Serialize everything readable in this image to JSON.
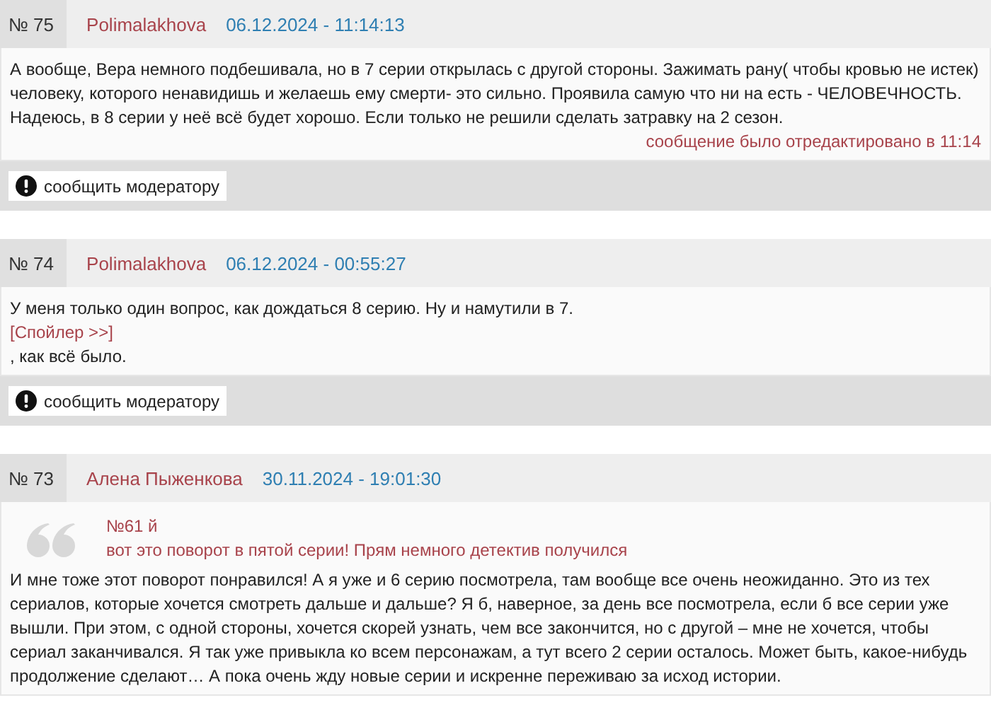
{
  "comments": [
    {
      "number": "№ 75",
      "author": "Polimalakhova",
      "date": "06.12.2024 - 11:14:13",
      "body": [
        {
          "kind": "text",
          "text": "А вообще, Вера немного подбешивала, но в 7 серии открылась с другой стороны. Зажимать рану( чтобы кровью не истек) человеку, которого ненавидишь и желаешь ему смерти- это сильно. Проявила самую что ни на есть - ЧЕЛОВЕЧНОСТЬ. Надеюсь, в 8 серии у неё всё будет хорошо. Если только не решили сделать затравку на 2 сезон."
        }
      ],
      "edited": "сообщение было отредактировано в 11:14",
      "report": "сообщить модератору"
    },
    {
      "number": "№ 74",
      "author": "Polimalakhova",
      "date": "06.12.2024 - 00:55:27",
      "body": [
        {
          "kind": "text",
          "text": "У меня только один вопрос, как дождаться 8 серию. Ну и намутили в 7."
        },
        {
          "kind": "spoiler",
          "text": "[Спойлер >>]"
        },
        {
          "kind": "text",
          "text": ", как всё было."
        }
      ],
      "report": "сообщить модератору"
    },
    {
      "number": "№ 73",
      "author": "Алена Пыженкова",
      "date": "30.11.2024 - 19:01:30",
      "quote": {
        "ref": "№61 й",
        "text": "вот это поворот в пятой серии! Прям немного детектив получился"
      },
      "body": [
        {
          "kind": "text",
          "text": "И мне тоже этот поворот понравился! А я уже и 6 серию посмотрела, там вообще все очень неожиданно. Это из тех сериалов, которые хочется смотреть дальше и дальше? Я б, наверное, за день все посмотрела, если б все серии уже вышли. При этом, с одной стороны, хочется скорей узнать, чем все закончится, но с другой – мне не хочется, чтобы сериал заканчивался. Я так уже привыкла ко всем персонажам, а тут всего 2 серии осталось. Может быть, какое-нибудь продолжение сделают… А пока очень жду новые серии и искренне переживаю за исход истории."
        }
      ]
    }
  ]
}
